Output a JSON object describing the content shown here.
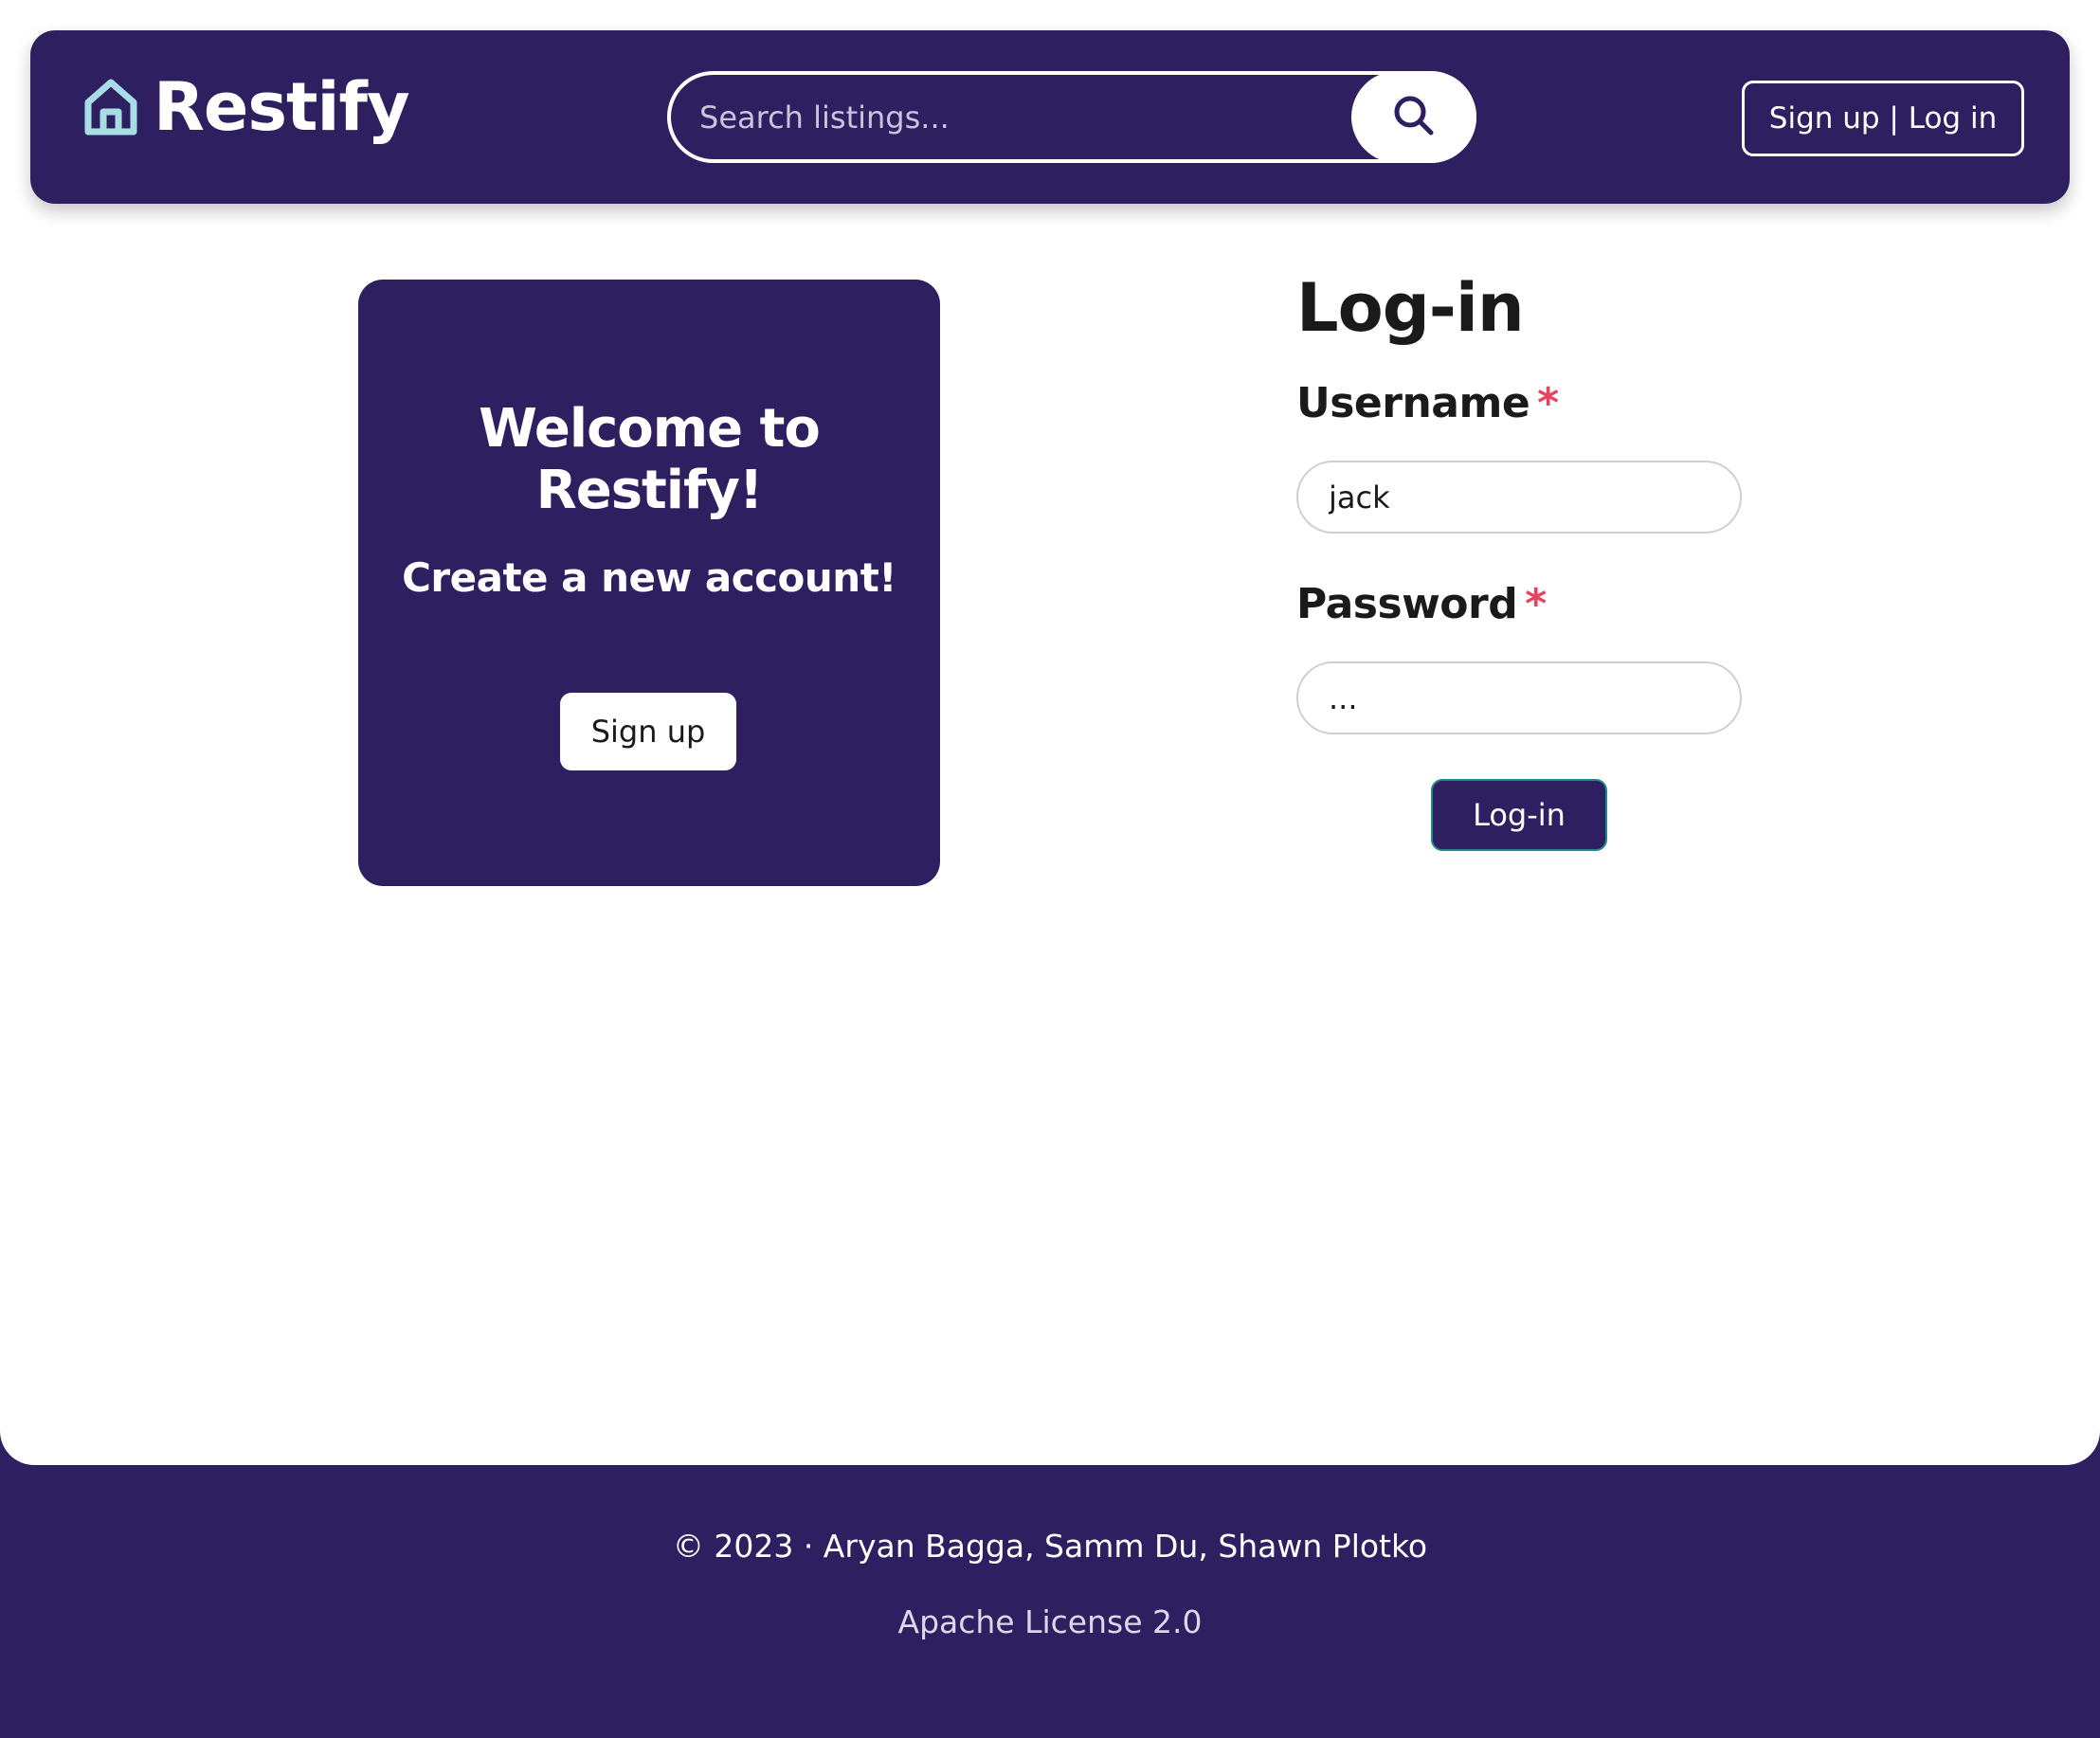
{
  "brand": {
    "name": "Restify",
    "icon": "house-icon",
    "icon_color": "#a9dde6"
  },
  "search": {
    "placeholder": "Search listings...",
    "icon": "search-icon"
  },
  "nav": {
    "auth_label": "Sign up | Log in"
  },
  "welcome": {
    "title": "Welcome to Restify!",
    "subtitle": "Create a new account!",
    "signup_label": "Sign up"
  },
  "login": {
    "title": "Log-in",
    "username_label": "Username",
    "username_value": "jack",
    "password_label": "Password",
    "password_value": "...",
    "required_mark": "*",
    "submit_label": "Log-in"
  },
  "footer": {
    "credits": "© 2023 · Aryan Bagga, Samm Du, Shawn Plotko",
    "license": "Apache License 2.0"
  },
  "colors": {
    "primary": "#2e2060",
    "required": "#e8435e",
    "accent_border": "#1f8a8a"
  }
}
